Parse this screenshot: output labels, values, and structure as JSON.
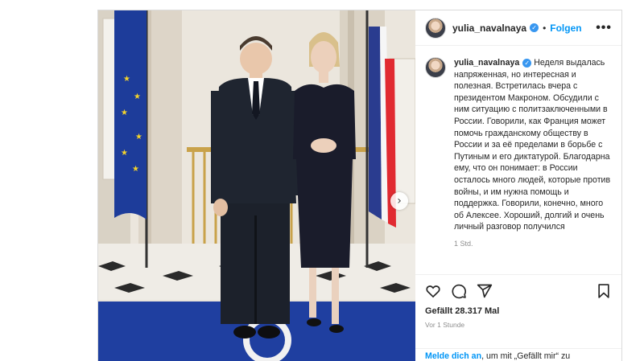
{
  "post": {
    "username": "yulia_navalnaya",
    "follow_label": "Folgen",
    "more_label": "•••",
    "caption": "Неделя выдалась напряженная, но интересная и полезная. Встретилась вчера с президентом Макроном. Обсудили с ним ситуацию с политзаключенными в России. Говорили, как Франция может помочь гражданскому обществу в России и за её пределами в борьбе с Путиным и его диктатурой. Благодарна ему, что он понимает: в России осталось много людей, которые против войны, и им нужна помощь и поддержка. Говорили, конечно, много об Алексее. Хороший, долгий и очень личный разговор получился",
    "caption_time": "1 Std.",
    "likes": "Gefällt 28.317 Mal",
    "posted_ago": "Vor 1 Stunde",
    "login_link": "Melde dich an",
    "login_text": ", um mit „Gefällt mir“ zu",
    "next_arrow": "›"
  },
  "icons": [
    "heart-icon",
    "comment-icon",
    "share-icon",
    "bookmark-icon",
    "verified-icon",
    "chevron-right-icon"
  ],
  "colors": {
    "link": "#0095f6",
    "verified": "#3897f0",
    "text": "#262626",
    "muted": "#8e8e8e"
  }
}
